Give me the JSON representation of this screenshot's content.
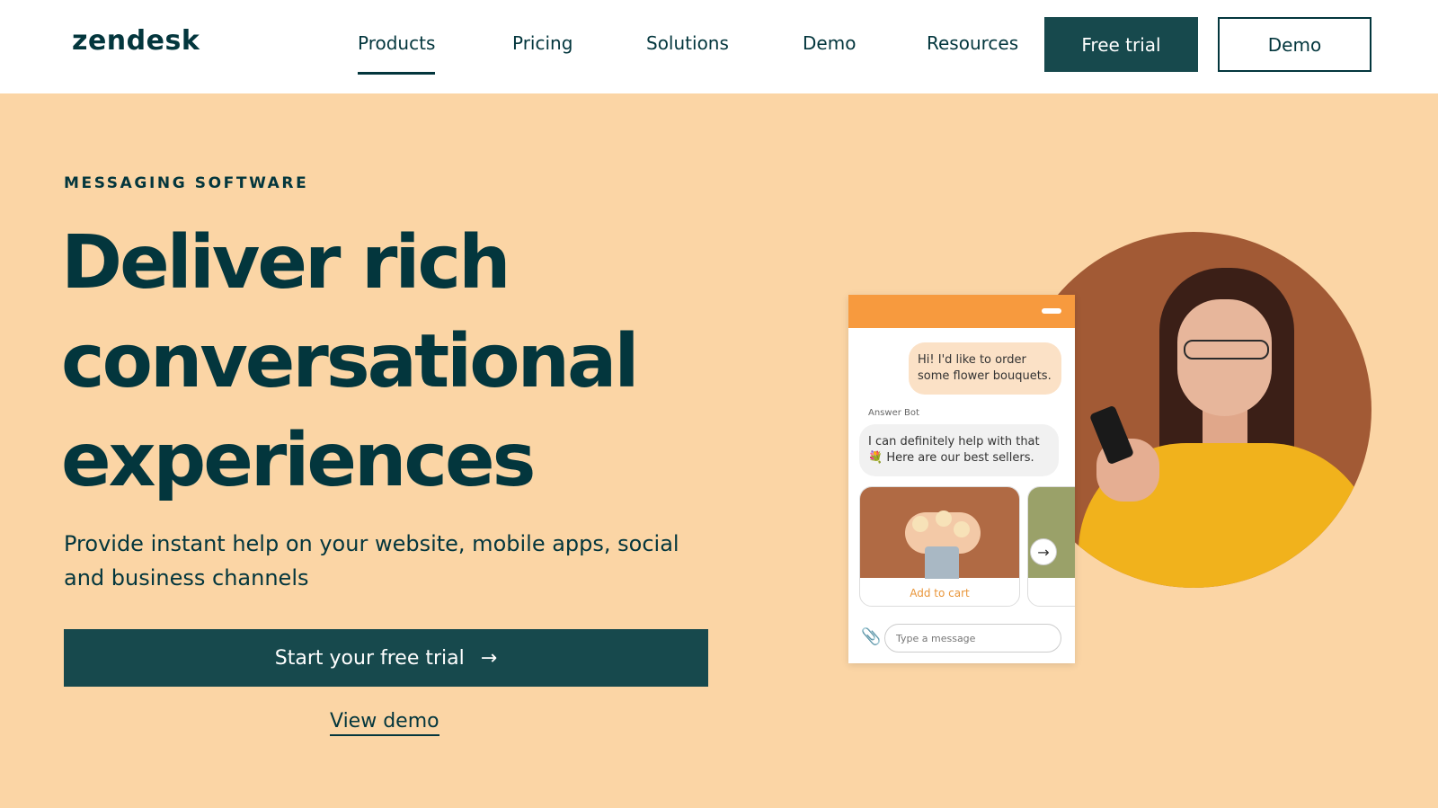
{
  "header": {
    "logo": "zendesk",
    "nav": [
      {
        "label": "Products",
        "active": true
      },
      {
        "label": "Pricing"
      },
      {
        "label": "Solutions"
      },
      {
        "label": "Demo"
      },
      {
        "label": "Resources"
      }
    ],
    "free_trial_label": "Free trial",
    "demo_label": "Demo"
  },
  "hero": {
    "eyebrow": "MESSAGING SOFTWARE",
    "headline_lines": [
      "Deliver rich",
      "conversational",
      "experiences"
    ],
    "subtext": "Provide instant help on your website, mobile apps, social and business channels",
    "cta_label": "Start your free trial",
    "cta_arrow": "→",
    "view_demo_label": "View demo"
  },
  "chat": {
    "user_message": "Hi! I'd like to order some flower bouquets.",
    "bot_label": "Answer Bot",
    "bot_message": "I can definitely help with that 💐 Here are our best sellers.",
    "card_action": "Add to cart",
    "next_arrow": "→",
    "attach_icon": "📎",
    "input_placeholder": "Type a message"
  },
  "colors": {
    "brand_dark": "#03363d",
    "button_teal": "#17494d",
    "hero_bg": "#fbd5a5",
    "chat_accent": "#f79a3e"
  }
}
